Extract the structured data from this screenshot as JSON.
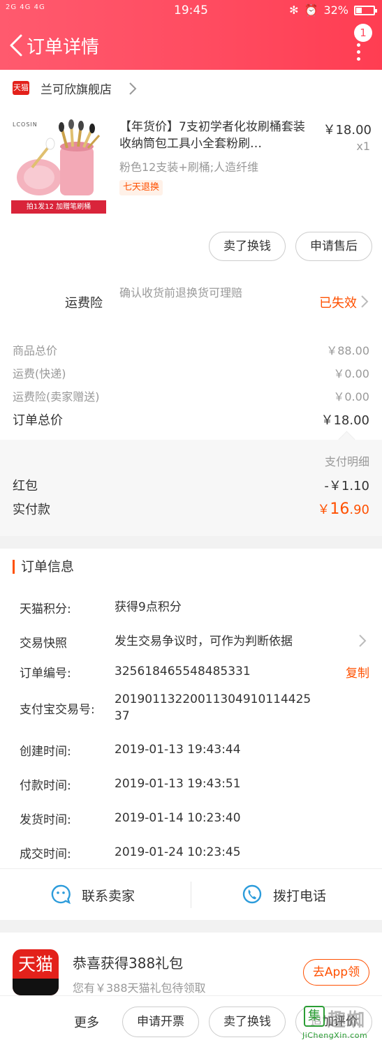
{
  "status_bar": {
    "left": "2G 4G 4G",
    "time": "19:45",
    "battery": "32%",
    "battery_level": 0.32
  },
  "nav": {
    "title": "订单详情",
    "badge": "1"
  },
  "shop": {
    "logo_text": "天猫",
    "name": "兰可欣旗舰店"
  },
  "product": {
    "brand": "LCOSIN",
    "promo_banner": "拍1发12 加赠笔刷桶",
    "title": "【年货价】7支初学者化妆刷桶套装收纳筒包工具小全套粉刷…",
    "price": "￥18.00",
    "qty": "x1",
    "sku": "粉色12支装+刷桶;人造纤维",
    "tag": "七天退换",
    "actions": [
      "卖了换钱",
      "申请售后"
    ]
  },
  "insurance": {
    "label": "运费险",
    "desc": "确认收货前退换货可理赔",
    "status": "已失效"
  },
  "summary": {
    "rows": [
      {
        "label": "商品总价",
        "value": "￥88.00"
      },
      {
        "label": "运费(快递)",
        "value": "￥0.00"
      },
      {
        "label": "运费险(卖家赠送)",
        "value": "￥0.00"
      }
    ],
    "total_label": "订单总价",
    "total_value": "￥18.00",
    "pay_detail": "支付明细",
    "redpacket_label": "红包",
    "redpacket_value": "-￥1.10",
    "paid_label": "实付款",
    "paid_currency": "￥",
    "paid_int": "16",
    "paid_dec": ".90"
  },
  "order_info": {
    "title": "订单信息",
    "rows": [
      {
        "label": "天猫积分:",
        "value": "获得9点积分"
      },
      {
        "label": "交易快照",
        "value": "发生交易争议时，可作为判断依据"
      },
      {
        "label": "订单编号:",
        "value": "325618465548485331",
        "action": "复制"
      },
      {
        "label": "支付宝交易号:",
        "value": "2019011322001130491011442537"
      },
      {
        "label": "创建时间:",
        "value": "2019-01-13 19:43:44"
      },
      {
        "label": "付款时间:",
        "value": "2019-01-13 19:43:51"
      },
      {
        "label": "发货时间:",
        "value": "2019-01-14 10:23:40"
      },
      {
        "label": "成交时间:",
        "value": "2019-01-24 10:23:45"
      }
    ]
  },
  "contact": {
    "seller": "联系卖家",
    "phone": "拨打电话"
  },
  "gift": {
    "logo_text": "天猫",
    "title": "恭喜获得388礼包",
    "subtitle": "您有￥388天猫礼包待领取",
    "button": "去App领"
  },
  "bottom": {
    "more": "更多",
    "invoice": "申请开票",
    "sell": "卖了换钱",
    "review": "追加评价"
  },
  "watermark": {
    "box": "集",
    "text": "趣蜘",
    "url": "JiChengXin.com"
  },
  "colors": {
    "header": "#ff4a5f",
    "accent": "#ff5000",
    "tmall_red": "#e3211b"
  }
}
